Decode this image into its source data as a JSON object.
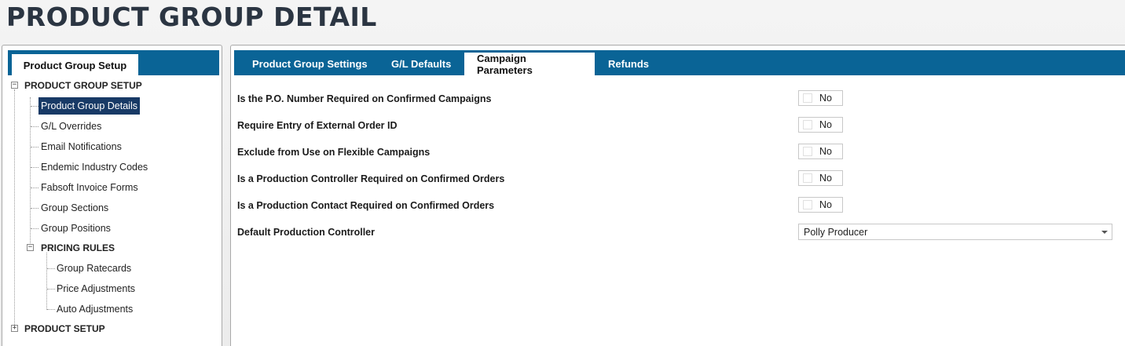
{
  "page_title": "PRODUCT GROUP DETAIL",
  "left_panel": {
    "tab_label": "Product Group Setup",
    "tree": {
      "group1": {
        "label": "PRODUCT GROUP SETUP",
        "expander": "−",
        "items": [
          "Product Group Details",
          "G/L Overrides",
          "Email Notifications",
          "Endemic Industry Codes",
          "Fabsoft Invoice Forms",
          "Group Sections",
          "Group Positions"
        ],
        "selected": "Product Group Details",
        "subgroup": {
          "label": "PRICING RULES",
          "expander": "−",
          "items": [
            "Group Ratecards",
            "Price Adjustments",
            "Auto Adjustments"
          ]
        }
      },
      "group2": {
        "label": "PRODUCT SETUP",
        "expander": "+"
      }
    }
  },
  "tabs": [
    "Product Group Settings",
    "G/L Defaults",
    "Campaign Parameters",
    "Refunds"
  ],
  "active_tab": "Campaign Parameters",
  "form": {
    "rows": [
      {
        "label": "Is the P.O. Number Required on Confirmed Campaigns",
        "value": "No"
      },
      {
        "label": "Require Entry of External Order ID",
        "value": "No"
      },
      {
        "label": "Exclude from Use on Flexible Campaigns",
        "value": "No"
      },
      {
        "label": "Is a Production Controller Required on Confirmed Orders",
        "value": "No"
      },
      {
        "label": "Is a Production Contact Required on Confirmed Orders",
        "value": "No"
      }
    ],
    "dropdown": {
      "label": "Default Production Controller",
      "value": "Polly Producer"
    }
  },
  "colors": {
    "accent": "#0a6496",
    "selected": "#183a66",
    "title": "#2b3542"
  }
}
